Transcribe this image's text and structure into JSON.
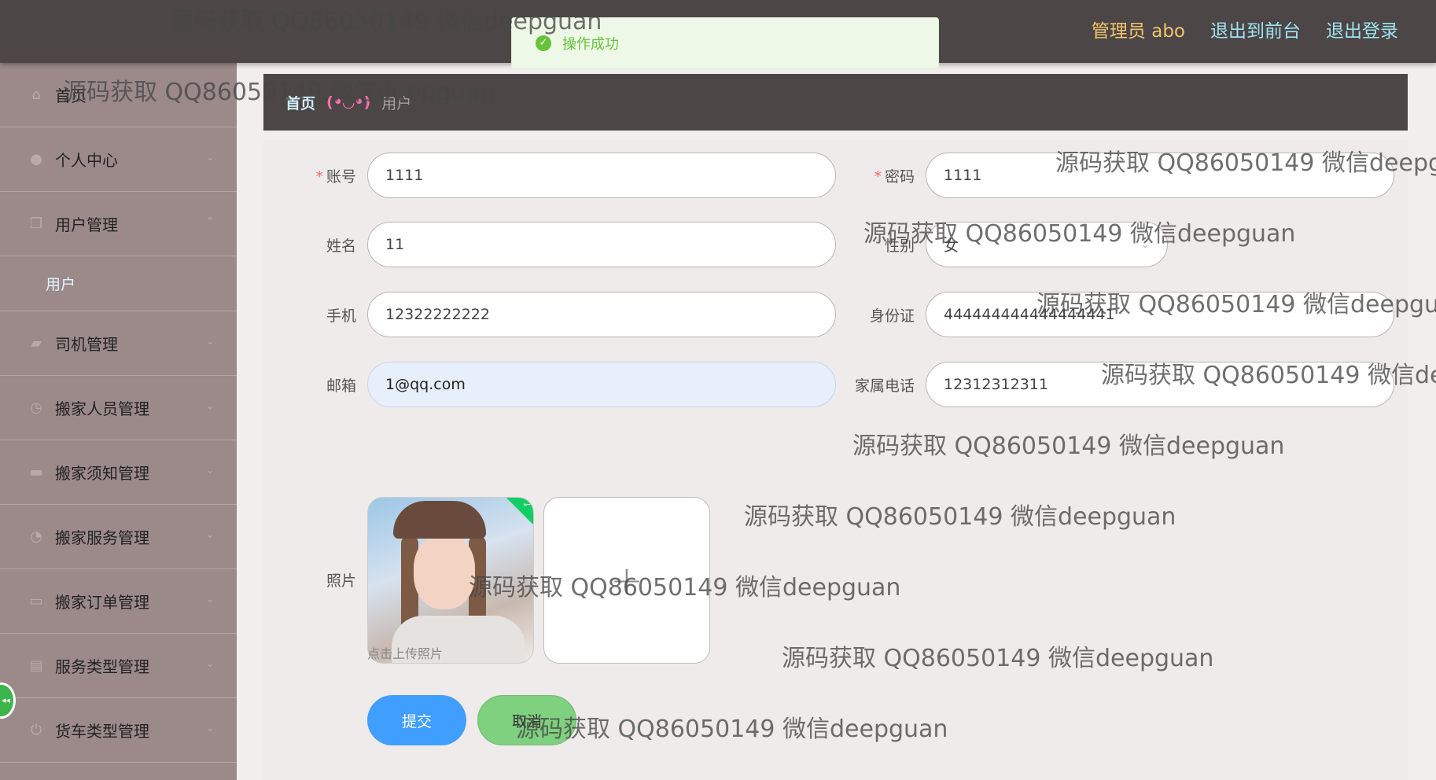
{
  "topbar": {
    "admin_label": "管理员 abo",
    "to_front": "退出到前台",
    "logout": "退出登录"
  },
  "toast": {
    "icon": "check-circle-icon",
    "text": "操作成功"
  },
  "sidebar": {
    "items": [
      {
        "label": "首页",
        "icon": "home-icon"
      },
      {
        "label": "个人中心",
        "icon": "user-icon"
      },
      {
        "label": "用户管理",
        "icon": "copy-icon"
      },
      {
        "label": "司机管理",
        "icon": "truck-icon"
      },
      {
        "label": "搬家人员管理",
        "icon": "clock-icon"
      },
      {
        "label": "搬家须知管理",
        "icon": "chat-icon"
      },
      {
        "label": "搬家服务管理",
        "icon": "compass-icon"
      },
      {
        "label": "搬家订单管理",
        "icon": "monitor-icon"
      },
      {
        "label": "服务类型管理",
        "icon": "clipboard-icon"
      },
      {
        "label": "货车类型管理",
        "icon": "power-icon"
      }
    ],
    "sub_user": "用户"
  },
  "breadcrumb": {
    "home": "首页",
    "sep": "(•◡•)",
    "current": "用户"
  },
  "form": {
    "account_label": "账号",
    "account_value": "1111",
    "password_label": "密码",
    "password_value": "1111",
    "name_label": "姓名",
    "name_value": "11",
    "gender_label": "性别",
    "gender_value": "女",
    "phone_label": "手机",
    "phone_value": "12322222222",
    "idcard_label": "身份证",
    "idcard_value": "444444444444444441",
    "email_label": "邮箱",
    "email_value": "1@qq.com",
    "family_label": "家属电话",
    "family_value": "12312312311",
    "photo_label": "照片",
    "upload_plus": "+",
    "upload_hint": "点击上传照片",
    "submit": "提交",
    "cancel": "取消"
  },
  "watermark": "源码获取 QQ86050149 微信deepguan",
  "colors": {
    "topbar": "#4c4646",
    "sidebar": "#9c8a8a",
    "primary": "#409eff",
    "success": "#67c23a"
  }
}
